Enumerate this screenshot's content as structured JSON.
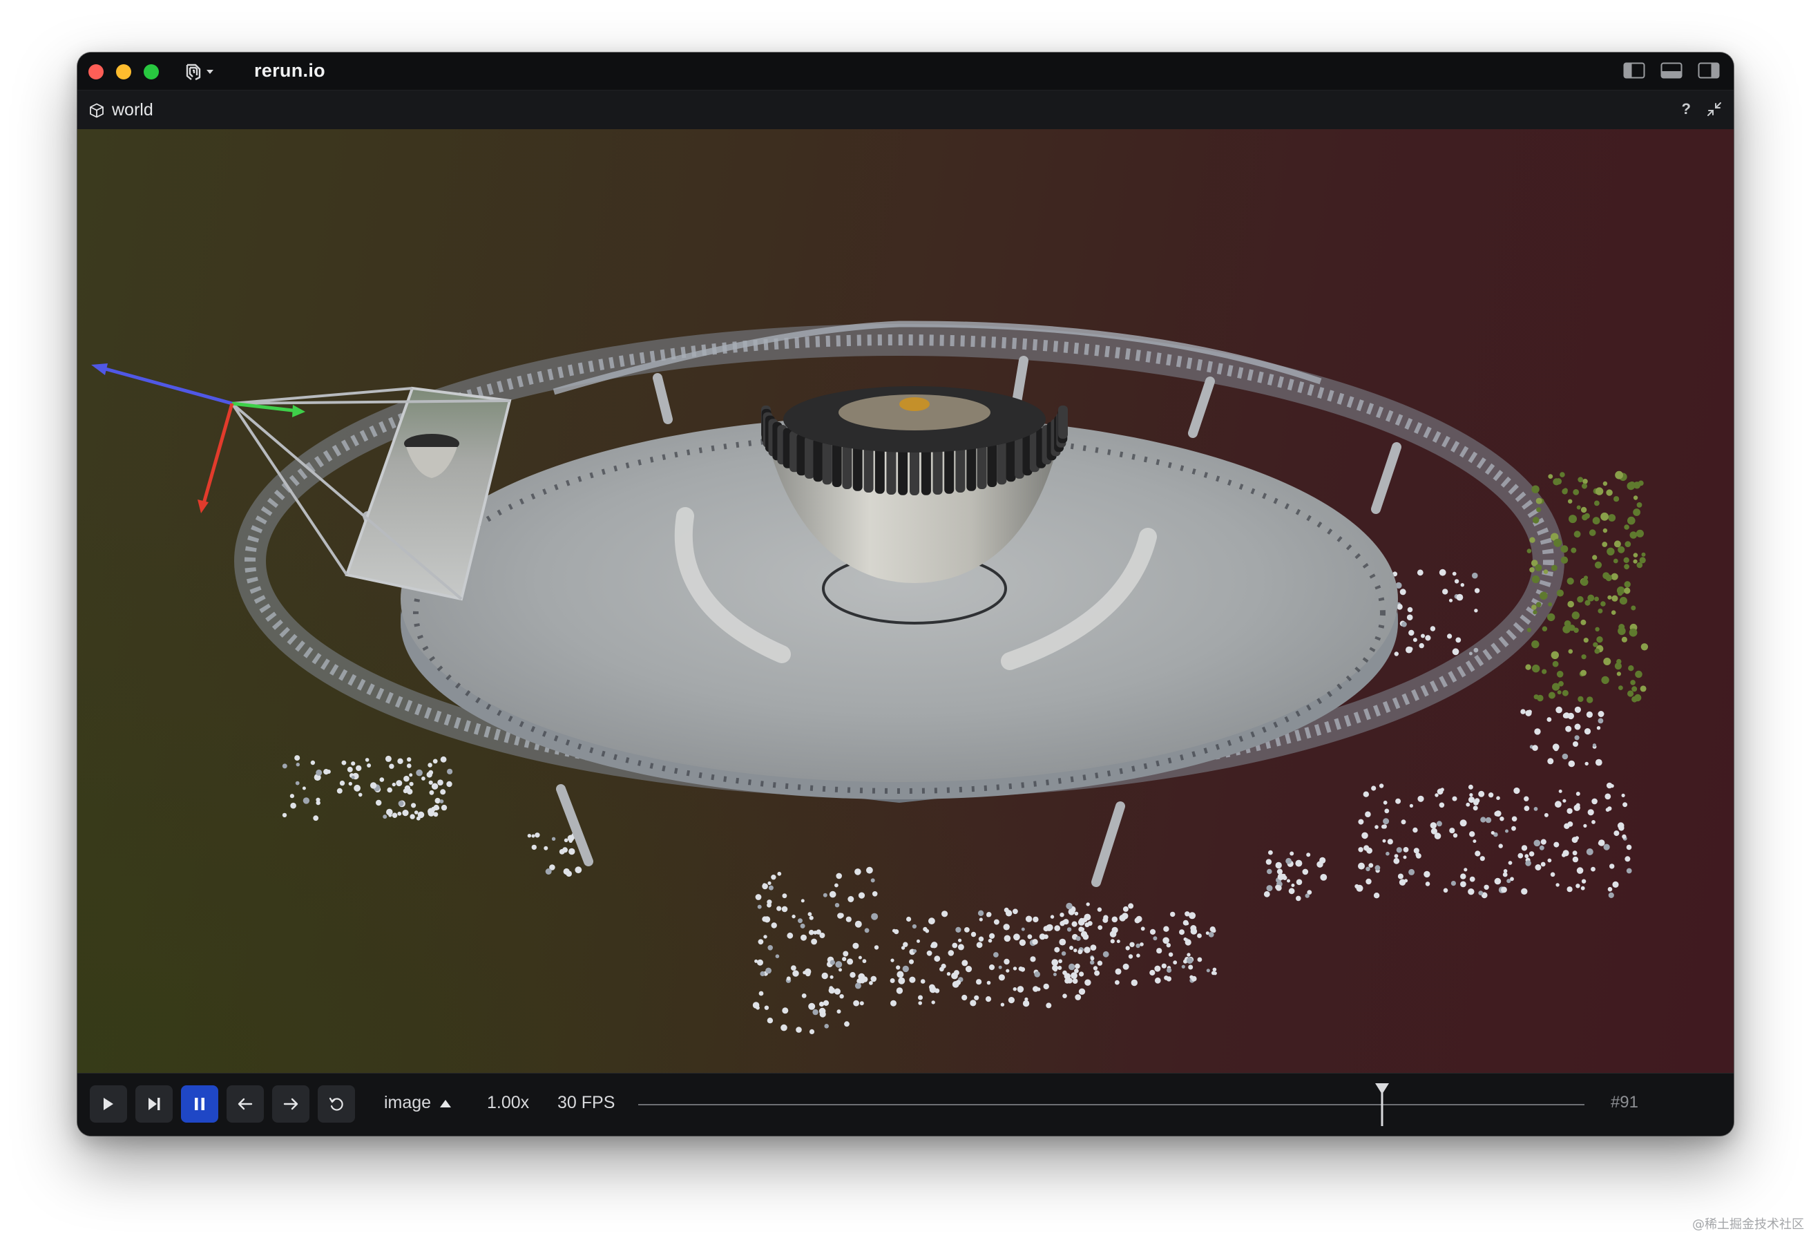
{
  "window": {
    "title": "rerun.io"
  },
  "space_view": {
    "name": "world",
    "help_label": "?"
  },
  "timeline": {
    "timeline_name": "image",
    "speed": "1.00x",
    "fps": "30 FPS",
    "frame_label": "#91",
    "playhead_fraction": 0.786
  },
  "watermark": "@稀土掘金技术社区",
  "colors": {
    "accent": "#1f47c6",
    "axis_x": "#e23b2c",
    "axis_y": "#3fd04a",
    "axis_z": "#5058e6"
  },
  "icons": {
    "close": "close-dot",
    "minimize": "minimize-dot",
    "zoom": "zoom-dot",
    "app_menu": "rerun-logo-icon",
    "space": "cube-icon",
    "play": "play-icon",
    "step": "step-forward-icon",
    "pause": "pause-icon",
    "back": "arrow-left-icon",
    "forward": "arrow-right-icon",
    "loop": "loop-icon"
  }
}
